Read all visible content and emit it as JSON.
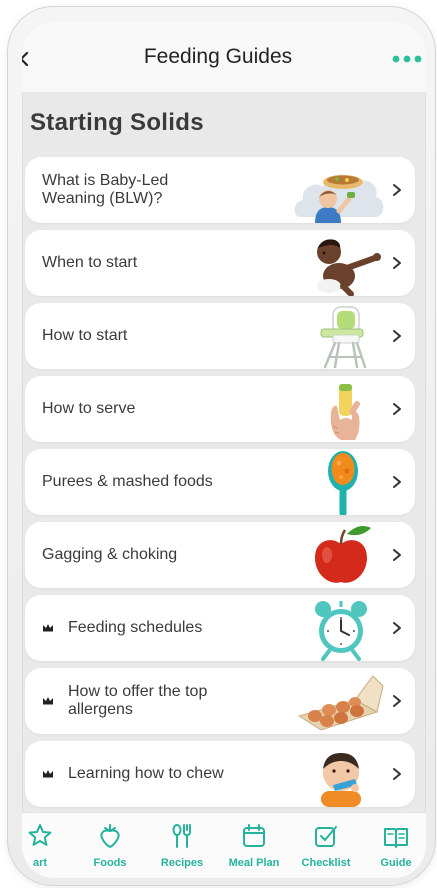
{
  "header": {
    "title": "Feeding Guides",
    "back_icon": "chevron-left-icon",
    "more_icon": "more-dots-icon"
  },
  "section": {
    "title": "Starting Solids"
  },
  "guides": [
    {
      "label": "What is Baby-Led Weaning (BLW)?",
      "premium": false,
      "image": "baby-eating-from-bowl"
    },
    {
      "label": "When to start",
      "premium": false,
      "image": "crawling-baby"
    },
    {
      "label": "How to start",
      "premium": false,
      "image": "high-chair"
    },
    {
      "label": "How to serve",
      "premium": false,
      "image": "hand-holding-food"
    },
    {
      "label": "Purees & mashed foods",
      "premium": false,
      "image": "spoon-with-puree"
    },
    {
      "label": "Gagging & choking",
      "premium": false,
      "image": "red-apple"
    },
    {
      "label": "Feeding schedules",
      "premium": true,
      "premium_icon": "crown-icon",
      "image": "alarm-clock"
    },
    {
      "label": "How to offer the top allergens",
      "premium": true,
      "premium_icon": "crown-icon",
      "image": "egg-carton"
    },
    {
      "label": "Learning how to chew",
      "premium": true,
      "premium_icon": "crown-icon",
      "image": "baby-with-teether"
    }
  ],
  "row_action_icon": "chevron-right-icon",
  "tabs": [
    {
      "label": "art",
      "icon": "star-icon"
    },
    {
      "label": "Foods",
      "icon": "strawberry-icon"
    },
    {
      "label": "Recipes",
      "icon": "utensils-icon"
    },
    {
      "label": "Meal Plan",
      "icon": "calendar-icon"
    },
    {
      "label": "Checklist",
      "icon": "checklist-icon"
    },
    {
      "label": "Guide",
      "icon": "book-icon"
    }
  ],
  "colors": {
    "accent": "#26b39c",
    "screen_background": "#e9e9e9",
    "header_background": "#f8f8f8",
    "card_background": "#ffffff",
    "text": "#3b3b3b"
  }
}
